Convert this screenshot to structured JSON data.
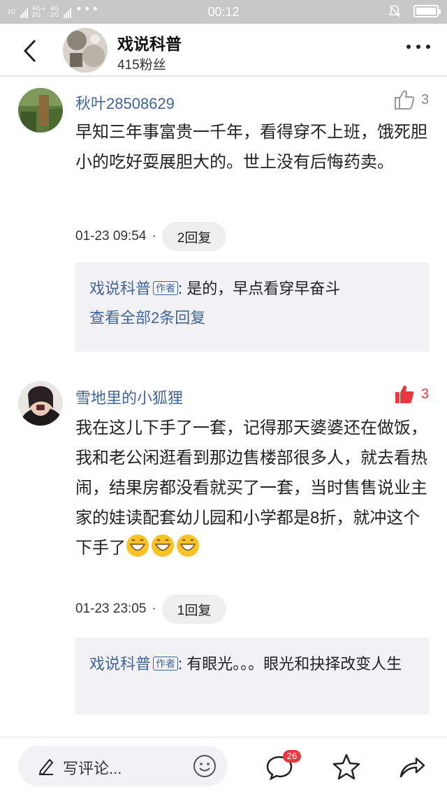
{
  "status_bar": {
    "network_left": "2G",
    "network_mid_top": "4G+",
    "network_mid_bottom": "2G",
    "network_right_top": "4G",
    "network_right_bottom": "2G",
    "dots": "•••",
    "time": "00:12"
  },
  "header": {
    "title": "戏说科普",
    "subtitle": "415粉丝"
  },
  "comments": [
    {
      "username": "秋叶28508629",
      "likes": "3",
      "liked": false,
      "text": "早知三年事富贵一千年，看得穿不上班，饿死胆小的吃好耍展胆大的。世上没有后悔药卖。",
      "time": "01-23 09:54",
      "separator": "·",
      "reply_button": "2回复",
      "reply": {
        "author": "戏说科普",
        "tag": "作者",
        "text": ": 是的，早点看穿早奋斗"
      },
      "see_all": "查看全部2条回复"
    },
    {
      "username": "雪地里的小狐狸",
      "likes": "3",
      "liked": true,
      "text": "我在这儿下手了一套，记得那天婆婆还在做饭，我和老公闲逛看到那边售楼部很多人，就去看热闹，结果房都没看就买了一套，当时售售说业主家的娃读配套幼儿园和小学都是8折，就冲这个下手了",
      "emoji": "grinning-face",
      "time": "01-23 23:05",
      "separator": "·",
      "reply_button": "1回复",
      "reply": {
        "author": "戏说科普",
        "tag": "作者",
        "text": ": 有眼光。。。眼光和抉择改变人生"
      }
    }
  ],
  "bottom_bar": {
    "write_placeholder": "写评论...",
    "comment_badge": "26",
    "icons": [
      "pen-icon",
      "smile-icon",
      "comment-icon",
      "star-icon",
      "share-icon"
    ]
  },
  "colors": {
    "link": "#406599",
    "like_active": "#e8383d",
    "reply_bg": "#f2f2f4",
    "status_bar": "#c7c7c7"
  }
}
